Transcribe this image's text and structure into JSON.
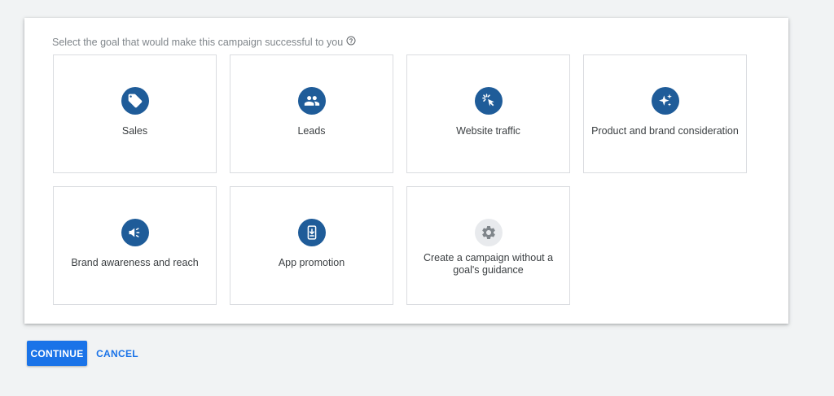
{
  "prompt": {
    "text": "Select the goal that would make this campaign successful to you",
    "help_icon": "help-circle-icon"
  },
  "goals": [
    {
      "label": "Sales",
      "icon": "tag-icon"
    },
    {
      "label": "Leads",
      "icon": "people-icon"
    },
    {
      "label": "Website traffic",
      "icon": "cursor-click-icon"
    },
    {
      "label": "Product and brand consideration",
      "icon": "sparkle-icon"
    },
    {
      "label": "Brand awareness and reach",
      "icon": "megaphone-icon"
    },
    {
      "label": "App promotion",
      "icon": "phone-download-icon"
    },
    {
      "label": "Create a campaign without a goal's guidance",
      "icon": "gear-icon"
    }
  ],
  "actions": {
    "continue_label": "CONTINUE",
    "cancel_label": "CANCEL"
  },
  "colors": {
    "accent": "#1a73e8",
    "icon_circle": "#1f5c99",
    "icon_circle_neutral": "#e8eaed",
    "background": "#f1f3f4"
  }
}
